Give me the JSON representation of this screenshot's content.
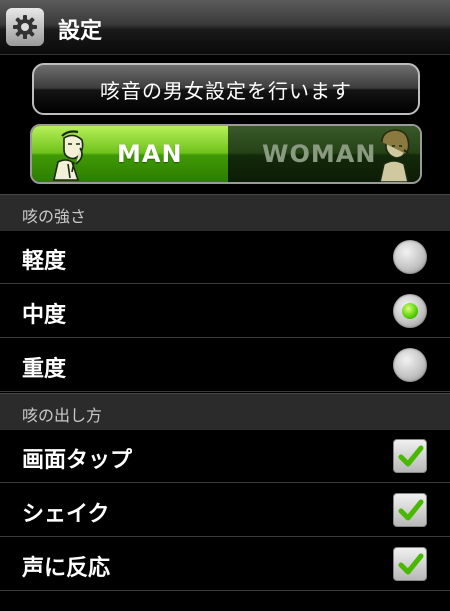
{
  "title_bar": {
    "title": "設定",
    "icon": "gear-icon"
  },
  "header_button": {
    "label": "咳音の男女設定を行います"
  },
  "gender_toggle": {
    "options": [
      "MAN",
      "WOMAN"
    ],
    "selected": "MAN",
    "active_color": "#5cc010"
  },
  "sections": [
    {
      "header": "咳の強さ",
      "type": "radio",
      "items": [
        {
          "label": "軽度",
          "selected": false
        },
        {
          "label": "中度",
          "selected": true
        },
        {
          "label": "重度",
          "selected": false
        }
      ]
    },
    {
      "header": "咳の出し方",
      "type": "checkbox",
      "items": [
        {
          "label": "画面タップ",
          "checked": true
        },
        {
          "label": "シェイク",
          "checked": true
        },
        {
          "label": "声に反応",
          "checked": true
        }
      ]
    }
  ]
}
